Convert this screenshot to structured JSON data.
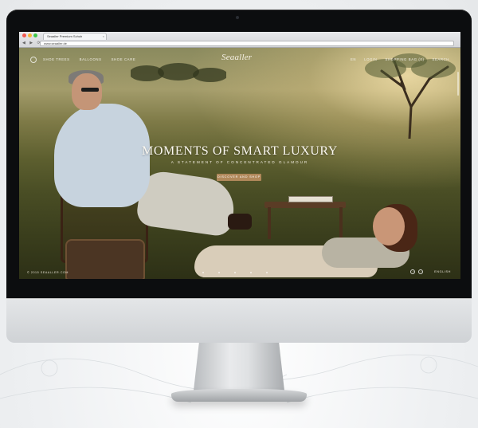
{
  "browser": {
    "tab_title": "Seaaller Premium Schuh",
    "tab_close": "×",
    "nav_buttons": "◀ ▶ ⟳",
    "url": "www.seaaller.de"
  },
  "site": {
    "logo": "Seaaller",
    "nav_left": [
      "SHOE TREES",
      "BALLOONS",
      "SHOE CARE"
    ],
    "nav_right": [
      "EN",
      "LOGIN",
      "SHOPPING BAG (0)",
      "SEARCH"
    ],
    "hero_title": "MOMENTS OF SMART LUXURY",
    "hero_subtitle": "A STATEMENT OF CONCENTRATED GLAMOUR",
    "cta": "DISCOVER AND SHOP",
    "footer_left": "© 2015 SEAALLER.COM",
    "footer_lang": "ENGLISH",
    "social": [
      "f",
      "t"
    ]
  },
  "colors": {
    "cta": "#b0885a",
    "bezel": "#0c0d0f"
  }
}
